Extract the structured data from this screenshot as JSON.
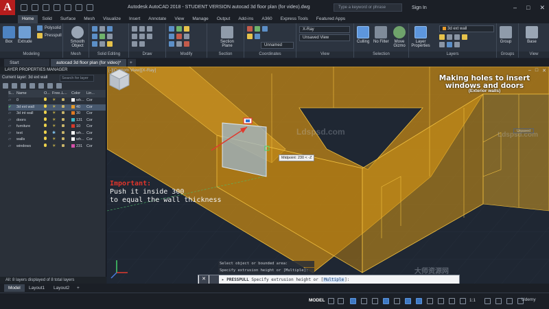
{
  "titlebar": {
    "title": "Autodesk AutoCAD 2018 - STUDENT VERSION    autocad 3d floor plan (for video).dwg",
    "search_placeholder": "Type a keyword or phrase",
    "sign_in": "Sign In",
    "logo_letter": "A"
  },
  "tabs": [
    "Home",
    "Solid",
    "Surface",
    "Mesh",
    "Visualize",
    "Insert",
    "Annotate",
    "View",
    "Manage",
    "Output",
    "Add-ins",
    "A360",
    "Express Tools",
    "Featured Apps"
  ],
  "ribbon": {
    "panels": [
      "Modeling",
      "Mesh",
      "Solid Editing",
      "Draw",
      "Modify",
      "Section",
      "Coordinates",
      "View",
      "Selection",
      "Layers",
      "Groups",
      "View"
    ],
    "buttons": {
      "box": "Box",
      "extrude": "Extrude",
      "polysolid": "Polysolid",
      "presspull": "Presspull",
      "smooth_object": "Smooth Object",
      "section_plane": "Section Plane",
      "culling": "Culling",
      "no_filter": "No Filter",
      "move_gizmo": "Move Gizmo",
      "layer_properties": "Layer Properties",
      "group": "Group",
      "base": "Base"
    },
    "dropdowns": {
      "visual_style": "X-Ray",
      "view": "Unsaved View",
      "ucs": "Unnamed",
      "layer": "3d ext wall"
    }
  },
  "doctabs": {
    "start": "Start",
    "active": "autocad 3d floor plan (for video)*"
  },
  "layer_manager": {
    "title": "LAYER PROPERTIES MANAGER",
    "current_layer": "Current layer: 3d ext wall",
    "search_placeholder": "Search for layer",
    "headers": [
      "S...",
      "Name",
      "O...",
      "Free...",
      "L...",
      "Color",
      "Lin..."
    ],
    "layers": [
      {
        "name": "0",
        "color_name": "wh...",
        "color_hex": "#ffffff",
        "lt": "Cor",
        "frozen": false
      },
      {
        "name": "3d ext wall",
        "color_name": "40",
        "color_hex": "#e69a2a",
        "lt": "Cor",
        "frozen": false,
        "current": true
      },
      {
        "name": "3d int wall",
        "color_name": "30",
        "color_hex": "#e07a22",
        "lt": "Cor",
        "frozen": false
      },
      {
        "name": "doors",
        "color_name": "131",
        "color_hex": "#3fb9c7",
        "lt": "Cor",
        "frozen": false
      },
      {
        "name": "furniture",
        "color_name": "10",
        "color_hex": "#d63a2a",
        "lt": "Cor",
        "frozen": false
      },
      {
        "name": "text",
        "color_name": "wh...",
        "color_hex": "#ffffff",
        "lt": "Cor",
        "frozen": true
      },
      {
        "name": "walls",
        "color_name": "wh...",
        "color_hex": "#ffffff",
        "lt": "Cor",
        "frozen": false
      },
      {
        "name": "windows",
        "color_name": "231",
        "color_hex": "#d24fa8",
        "lt": "Cor",
        "frozen": false
      }
    ],
    "status": "All: 8 layers displayed of 8 total layers"
  },
  "viewport": {
    "label": "[-][Custom View][X-Ray]",
    "annotation_title": "Making holes to insert windows and doors",
    "annotation_sub": "(Exterior walls)",
    "important": "Important:",
    "note_line1": "Push it inside 300",
    "note_line2": "to equal the wall thickness",
    "tooltip": "Midpoint: 230 < -Z",
    "viewcube_label": "Unsaved",
    "watermark_center": "Ldspsd.com",
    "watermark_right": "Ldspsd.com",
    "watermark_bottom": "大师资源网"
  },
  "command": {
    "history1": "Select object or bounded area:",
    "history2": "Specify extrusion height or [Multiple]:",
    "prompt_cmd": "PRESSPULL",
    "prompt_text": "Specify extrusion height or",
    "prompt_option": "Multiple",
    "prompt_end": ":"
  },
  "layout_tabs": [
    "Model",
    "Layout1",
    "Layout2"
  ],
  "statusbar": {
    "model": "MODEL",
    "scale": "1:1",
    "brand": "Udemy"
  },
  "colors": {
    "wall_fill": "#c98a14",
    "wall_edge": "#f0c040",
    "accent_blue": "#3e78c2",
    "important_red": "#e0352b"
  }
}
